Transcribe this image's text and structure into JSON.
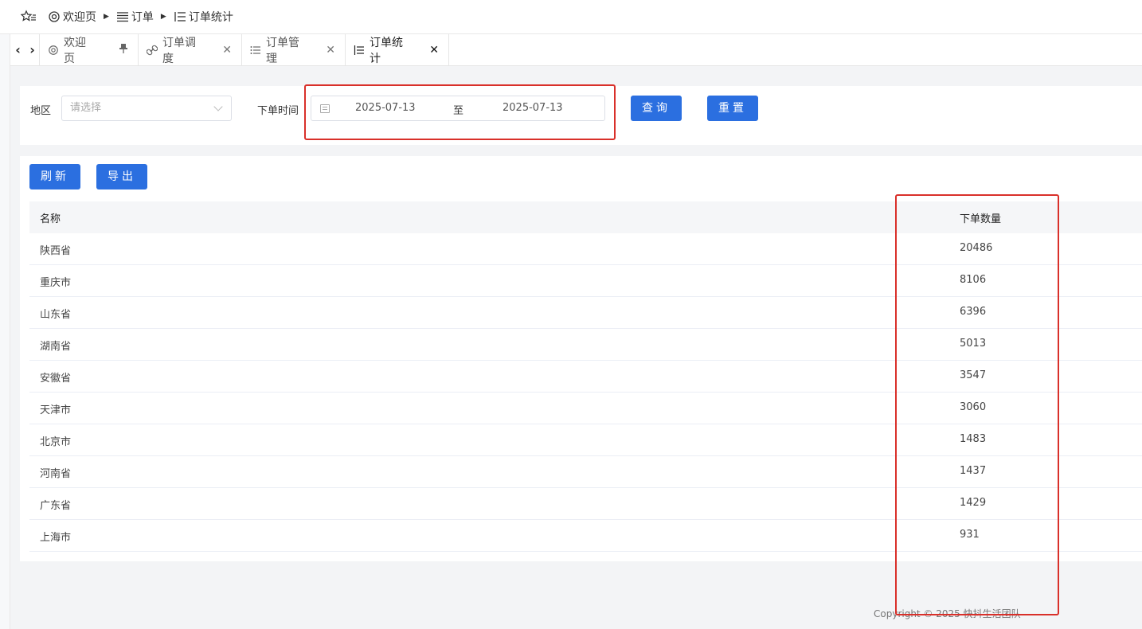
{
  "breadcrumb": {
    "items": [
      {
        "label": "欢迎页",
        "icon": "dashboard-icon"
      },
      {
        "label": "订单",
        "icon": "list-icon"
      },
      {
        "label": "订单统计",
        "icon": "stats-list-icon"
      }
    ]
  },
  "tabs": [
    {
      "label": "欢迎页",
      "icon": "dashboard-icon",
      "action": "pin-icon"
    },
    {
      "label": "订单调度",
      "icon": "link-icon",
      "action": "close-icon"
    },
    {
      "label": "订单管理",
      "icon": "list-icon",
      "action": "close-icon"
    },
    {
      "label": "订单统计",
      "icon": "stats-list-icon",
      "action": "close-icon",
      "active": true
    }
  ],
  "search": {
    "region_label": "地区",
    "region_placeholder": "请选择",
    "date_label": "下单时间",
    "date_start": "2025-07-13",
    "date_sep": "至",
    "date_end": "2025-07-13",
    "query_label": "查询",
    "reset_label": "重置"
  },
  "toolbar": {
    "refresh_label": "刷新",
    "export_label": "导出"
  },
  "table": {
    "columns": [
      "名称",
      "下单数量"
    ],
    "rows": [
      [
        "陕西省",
        "20486"
      ],
      [
        "重庆市",
        "8106"
      ],
      [
        "山东省",
        "6396"
      ],
      [
        "湖南省",
        "5013"
      ],
      [
        "安徽省",
        "3547"
      ],
      [
        "天津市",
        "3060"
      ],
      [
        "北京市",
        "1483"
      ],
      [
        "河南省",
        "1437"
      ],
      [
        "广东省",
        "1429"
      ],
      [
        "上海市",
        "931"
      ]
    ]
  },
  "footer": {
    "copyright": "Copyright © 2025 快抖生活团队"
  },
  "colors": {
    "primary": "#2b6fe0",
    "annotation": "#d9302a"
  }
}
